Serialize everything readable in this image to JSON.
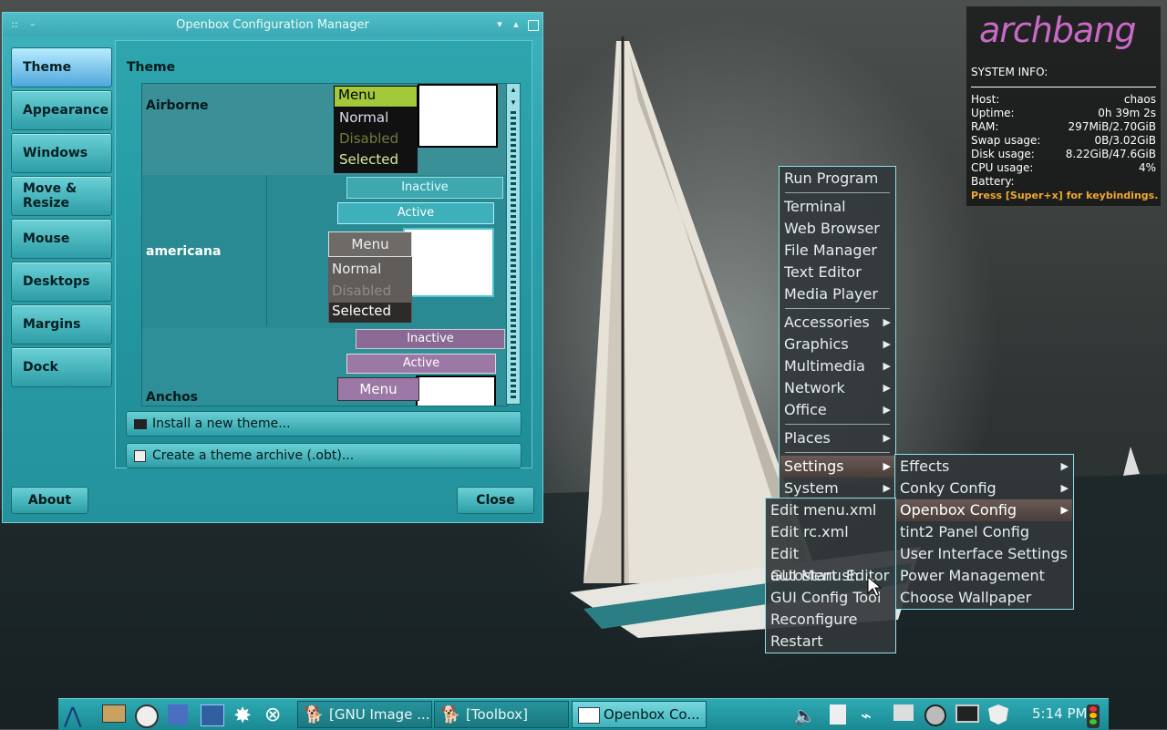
{
  "window": {
    "title": "Openbox Configuration Manager",
    "sidebar": [
      "Theme",
      "Appearance",
      "Windows",
      "Move & Resize",
      "Mouse",
      "Desktops",
      "Margins",
      "Dock"
    ],
    "panel_title": "Theme",
    "themes": [
      "Airborne",
      "americana",
      "Anchos"
    ],
    "preview": {
      "menu": "Menu",
      "normal": "Normal",
      "disabled": "Disabled",
      "selected": "Selected",
      "inactive": "Inactive",
      "active": "Active"
    },
    "install_label": "Install a new theme...",
    "archive_label": "Create a theme archive (.obt)...",
    "about_label": "About",
    "close_label": "Close"
  },
  "conky": {
    "logo": "archbang",
    "header": "SYSTEM INFO:",
    "rows": [
      {
        "k": "Host:",
        "v": "chaos"
      },
      {
        "k": "Uptime:",
        "v": "0h 39m 2s"
      },
      {
        "k": "RAM:",
        "v": "297MiB/2.70GiB"
      },
      {
        "k": "Swap usage:",
        "v": "0B/3.02GiB"
      },
      {
        "k": "Disk usage:",
        "v": "8.22GiB/47.6GiB"
      },
      {
        "k": "CPU usage:",
        "v": "4%"
      },
      {
        "k": "Battery:",
        "v": ""
      }
    ],
    "hint": "Press [Super+x] for keybindings.",
    "hint_color": "#f0a830"
  },
  "root_menu": {
    "items": [
      "Run Program",
      "Terminal",
      "Web Browser",
      "File Manager",
      "Text Editor",
      "Media Player",
      "Accessories",
      "Graphics",
      "Multimedia",
      "Network",
      "Office",
      "Places",
      "Settings",
      "System"
    ]
  },
  "settings_menu": {
    "items": [
      "Effects",
      "Conky Config",
      "Openbox Config",
      "tint2 Panel Config",
      "User Interface Settings",
      "Power Management",
      "Choose Wallpaper"
    ]
  },
  "openbox_menu": {
    "items": [
      "Edit menu.xml",
      "Edit rc.xml",
      "Edit autostart.sh",
      "GUI Menu Editor",
      "GUI Config Tool",
      "Reconfigure",
      "Restart"
    ]
  },
  "taskbar": {
    "tasks": [
      "[GNU Image ...",
      "[Toolbox]",
      "Openbox Co..."
    ],
    "clock": "5:14 PM"
  }
}
